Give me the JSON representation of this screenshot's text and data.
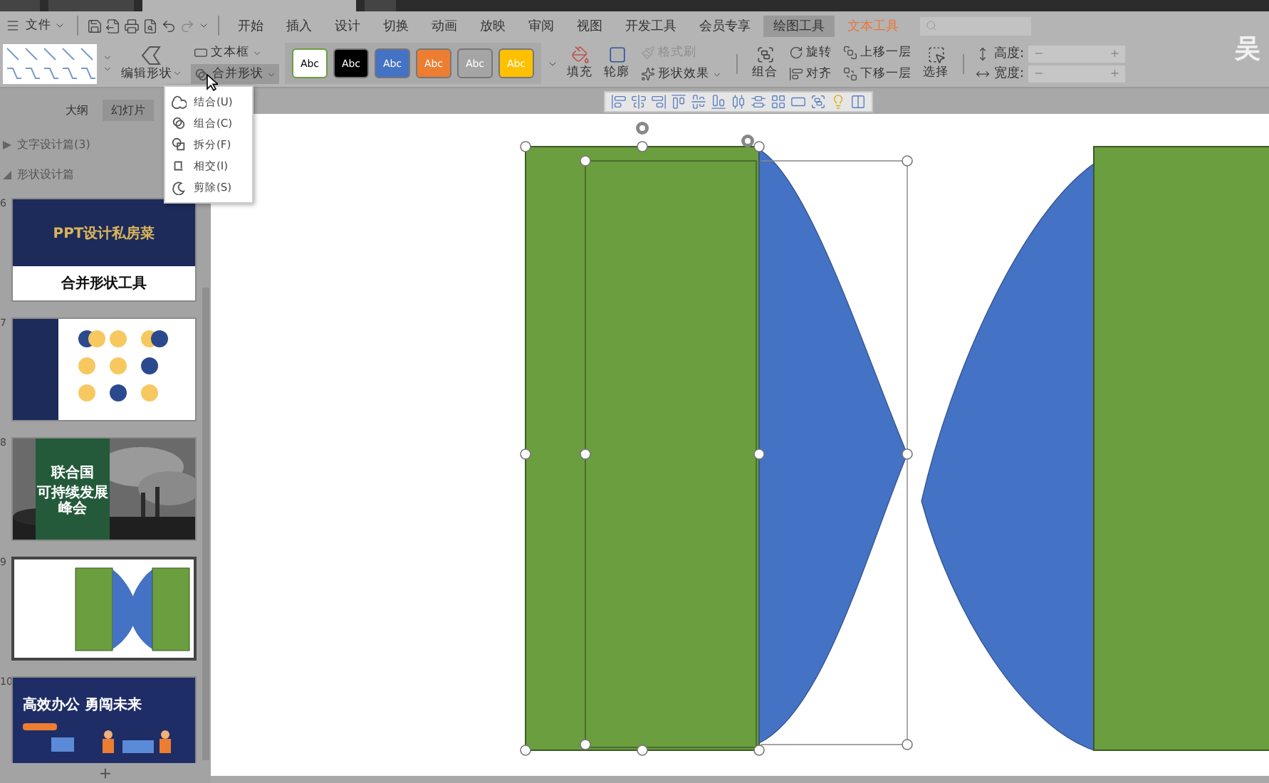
{
  "window_tabs": [
    {
      "selected": false
    },
    {
      "selected": false
    },
    {
      "selected": true
    },
    {
      "selected": false
    }
  ],
  "menu_bar": {
    "file_menu": "文件",
    "tabs": [
      {
        "label": "开始",
        "selected": false,
        "highlighted": false
      },
      {
        "label": "插入",
        "selected": false,
        "highlighted": false
      },
      {
        "label": "设计",
        "selected": false,
        "highlighted": false
      },
      {
        "label": "切换",
        "selected": false,
        "highlighted": false
      },
      {
        "label": "动画",
        "selected": false,
        "highlighted": false
      },
      {
        "label": "放映",
        "selected": false,
        "highlighted": false
      },
      {
        "label": "审阅",
        "selected": false,
        "highlighted": false
      },
      {
        "label": "视图",
        "selected": false,
        "highlighted": false
      },
      {
        "label": "开发工具",
        "selected": false,
        "highlighted": false
      },
      {
        "label": "会员专享",
        "selected": false,
        "highlighted": false
      },
      {
        "label": "绘图工具",
        "selected": true,
        "highlighted": false
      },
      {
        "label": "文本工具",
        "selected": false,
        "highlighted": true
      }
    ],
    "user_initial": "吴"
  },
  "ribbon": {
    "edit_shape": "编辑形状",
    "text_box": "文本框",
    "merge_shapes": {
      "label": "合并形状",
      "open": true
    },
    "style_swatches": [
      {
        "label": "Abc",
        "color": "#ffffff"
      },
      {
        "label": "Abc",
        "color": "#000000"
      },
      {
        "label": "Abc",
        "color": "#4472c4"
      },
      {
        "label": "Abc",
        "color": "#ed7d31"
      },
      {
        "label": "Abc",
        "color": "#a5a5a5"
      },
      {
        "label": "Abc",
        "color": "#ffc000"
      }
    ],
    "fill": "填充",
    "outline": "轮廓",
    "format_painter": {
      "label": "格式刷",
      "disabled": true
    },
    "shape_effects": "形状效果",
    "group": "组合",
    "rotate": "旋转",
    "align": "对齐",
    "bring_forward": "上移一层",
    "send_backward": "下移一层",
    "select": "选择",
    "size_fields": [
      {
        "label": "高度:",
        "minus": "−",
        "plus": "+"
      },
      {
        "label": "宽度:",
        "minus": "−",
        "plus": "+"
      }
    ]
  },
  "merge_menu": [
    {
      "label": "结合(U)",
      "kind": "union"
    },
    {
      "label": "组合(C)",
      "kind": "combine"
    },
    {
      "label": "拆分(F)",
      "kind": "fragment"
    },
    {
      "label": "相交(I)",
      "kind": "intersect"
    },
    {
      "label": "剪除(S)",
      "kind": "subtract"
    }
  ],
  "left_panel": {
    "tabs": [
      {
        "label": "大纲",
        "selected": false
      },
      {
        "label": "幻灯片",
        "selected": true
      }
    ],
    "sections": [
      {
        "title": "文字设计篇(3)",
        "expanded": false
      },
      {
        "title": "形状设计篇",
        "expanded": true,
        "slides": [
          {
            "number": "6",
            "kind": "title",
            "selected": false,
            "heading": "PPT设计私房菜",
            "caption": "合并形状工具"
          },
          {
            "number": "7",
            "kind": "circles",
            "selected": false
          },
          {
            "number": "8",
            "selected": false,
            "heading": "联合国",
            "caption": "可持续发展峰会"
          },
          {
            "number": "9",
            "kind": "shapes",
            "selected": true
          },
          {
            "number": "10",
            "kind": "banner",
            "selected": false,
            "heading": "高效办公 勇闯未来"
          }
        ]
      }
    ],
    "add_slide": "+"
  }
}
